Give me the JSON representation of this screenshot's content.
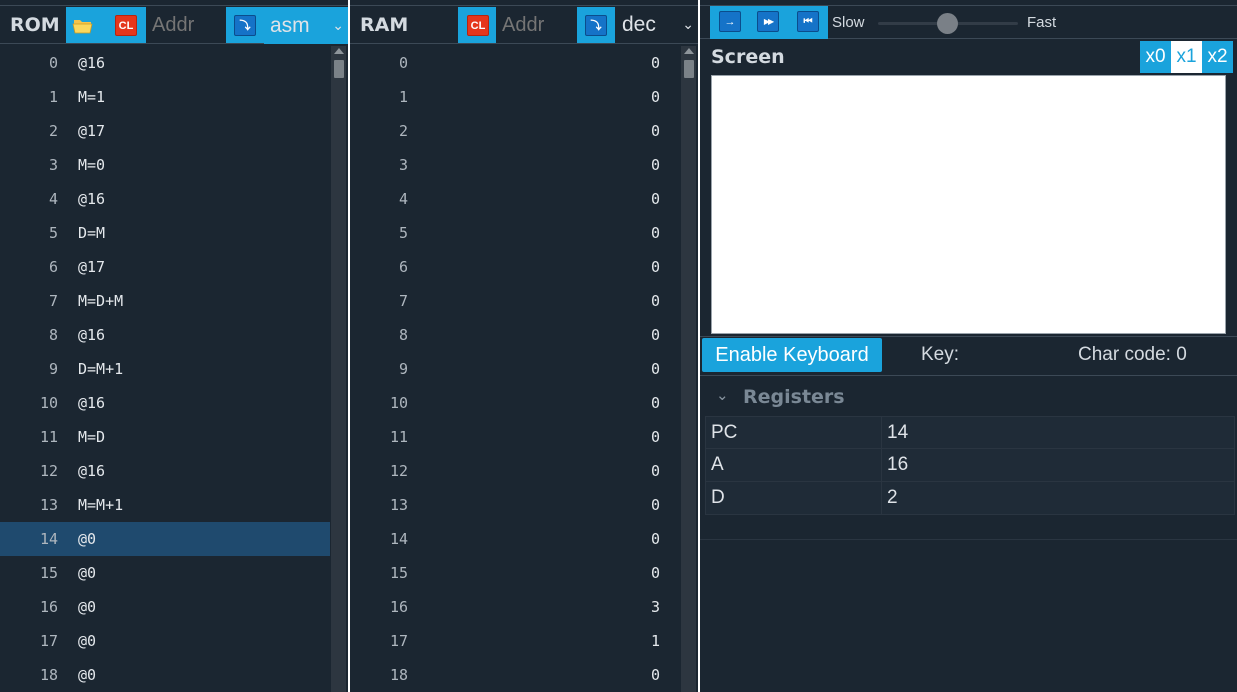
{
  "rom": {
    "title": "ROM",
    "open_icon": "folder-icon",
    "clear_label": "CL",
    "addr_placeholder": "Addr",
    "jump_glyph": "⤵",
    "format_value": "asm",
    "active_row": 14,
    "rows": [
      {
        "addr": "0",
        "value": "@16"
      },
      {
        "addr": "1",
        "value": "M=1"
      },
      {
        "addr": "2",
        "value": "@17"
      },
      {
        "addr": "3",
        "value": "M=0"
      },
      {
        "addr": "4",
        "value": "@16"
      },
      {
        "addr": "5",
        "value": "D=M"
      },
      {
        "addr": "6",
        "value": "@17"
      },
      {
        "addr": "7",
        "value": "M=D+M"
      },
      {
        "addr": "8",
        "value": "@16"
      },
      {
        "addr": "9",
        "value": "D=M+1"
      },
      {
        "addr": "10",
        "value": "@16"
      },
      {
        "addr": "11",
        "value": "M=D"
      },
      {
        "addr": "12",
        "value": "@16"
      },
      {
        "addr": "13",
        "value": "M=M+1"
      },
      {
        "addr": "14",
        "value": "@0"
      },
      {
        "addr": "15",
        "value": "@0"
      },
      {
        "addr": "16",
        "value": "@0"
      },
      {
        "addr": "17",
        "value": "@0"
      },
      {
        "addr": "18",
        "value": "@0"
      }
    ]
  },
  "ram": {
    "title": "RAM",
    "clear_label": "CL",
    "addr_placeholder": "Addr",
    "jump_glyph": "⤵",
    "format_value": "dec",
    "rows": [
      {
        "addr": "0",
        "value": "0"
      },
      {
        "addr": "1",
        "value": "0"
      },
      {
        "addr": "2",
        "value": "0"
      },
      {
        "addr": "3",
        "value": "0"
      },
      {
        "addr": "4",
        "value": "0"
      },
      {
        "addr": "5",
        "value": "0"
      },
      {
        "addr": "6",
        "value": "0"
      },
      {
        "addr": "7",
        "value": "0"
      },
      {
        "addr": "8",
        "value": "0"
      },
      {
        "addr": "9",
        "value": "0"
      },
      {
        "addr": "10",
        "value": "0"
      },
      {
        "addr": "11",
        "value": "0"
      },
      {
        "addr": "12",
        "value": "0"
      },
      {
        "addr": "13",
        "value": "0"
      },
      {
        "addr": "14",
        "value": "0"
      },
      {
        "addr": "15",
        "value": "0"
      },
      {
        "addr": "16",
        "value": "3"
      },
      {
        "addr": "17",
        "value": "1"
      },
      {
        "addr": "18",
        "value": "0"
      }
    ]
  },
  "runbar": {
    "step_glyph": "→",
    "run_glyph": "▶▶",
    "reset_glyph": "⏮",
    "speed_slow": "Slow",
    "speed_fast": "Fast",
    "speed_level": 0.5
  },
  "screen": {
    "title": "Screen",
    "zoom_options": [
      "x0",
      "x1",
      "x2"
    ],
    "zoom_selected": "x1"
  },
  "keyboard": {
    "enable_label": "Enable Keyboard",
    "key_label": "Key:",
    "char_code_label": "Char code: 0"
  },
  "registers": {
    "title": "Registers",
    "rows": [
      {
        "name": "PC",
        "value": "14"
      },
      {
        "name": "A",
        "value": "16"
      },
      {
        "name": "D",
        "value": "2"
      }
    ]
  },
  "colors": {
    "accent": "#1aa3dc",
    "panel_bg": "#1b2631",
    "active_row": "#1f4a6e",
    "clear_red": "#e5361c"
  }
}
